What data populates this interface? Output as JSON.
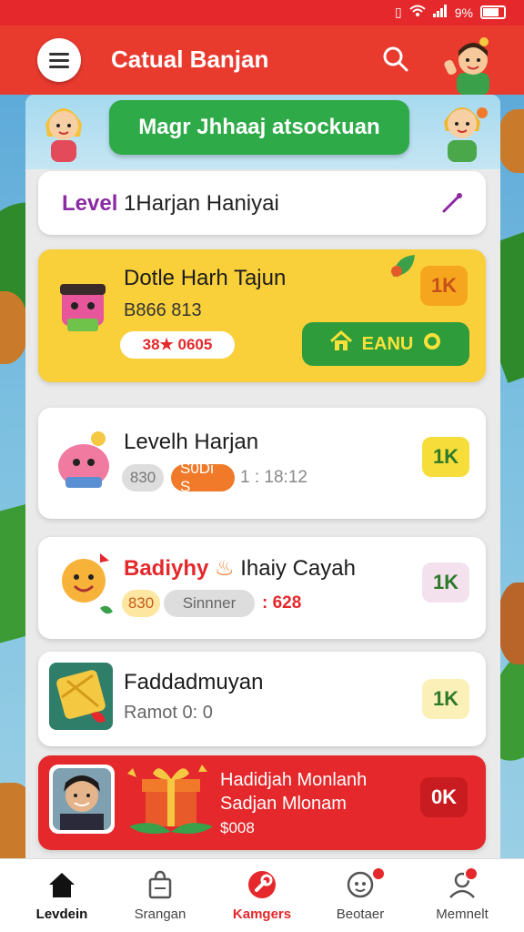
{
  "status": {
    "pct": "9%"
  },
  "header": {
    "title": "Catual Banjan"
  },
  "banner": {
    "button_label": "Magr Jhhaaj atsockuan"
  },
  "level_bar": {
    "prefix": "Level",
    "rest": " 1Harjan Haniyai"
  },
  "cards": [
    {
      "title": "Dotle Harh Tajun",
      "sub": "B866 813",
      "pill": "38★ 0605",
      "badge": "1K",
      "button_label": "EANU"
    },
    {
      "title": "Levelh Harjan",
      "pill_a": "830",
      "pill_b": "S0Di S",
      "time": "1 : 18:12",
      "badge": "1K"
    },
    {
      "title_red": "Badiyhy",
      "title_rest": " Ihaiy Cayah",
      "pill_a": "830",
      "pill_b": "Sinnner",
      "value": ": 628",
      "badge": "1K"
    },
    {
      "title": "Faddadmuyan",
      "sub": "Ramot 0: 0",
      "badge": "1K"
    },
    {
      "title_line1": "Hadidjah Monlanh",
      "title_line2": "Sadjan Mlonam",
      "price": "$008",
      "badge": "0K"
    }
  ],
  "tabs": [
    {
      "label": "Levdein",
      "icon": "home-icon"
    },
    {
      "label": "Srangan",
      "icon": "bag-icon"
    },
    {
      "label": "Kamgers",
      "icon": "wrench-icon"
    },
    {
      "label": "Beotaer",
      "icon": "chat-icon"
    },
    {
      "label": "Memnelt",
      "icon": "user-icon"
    }
  ],
  "colors": {
    "primary": "#e93a2e",
    "green": "#2eaa48",
    "yellow_card": "#f9d03a"
  }
}
